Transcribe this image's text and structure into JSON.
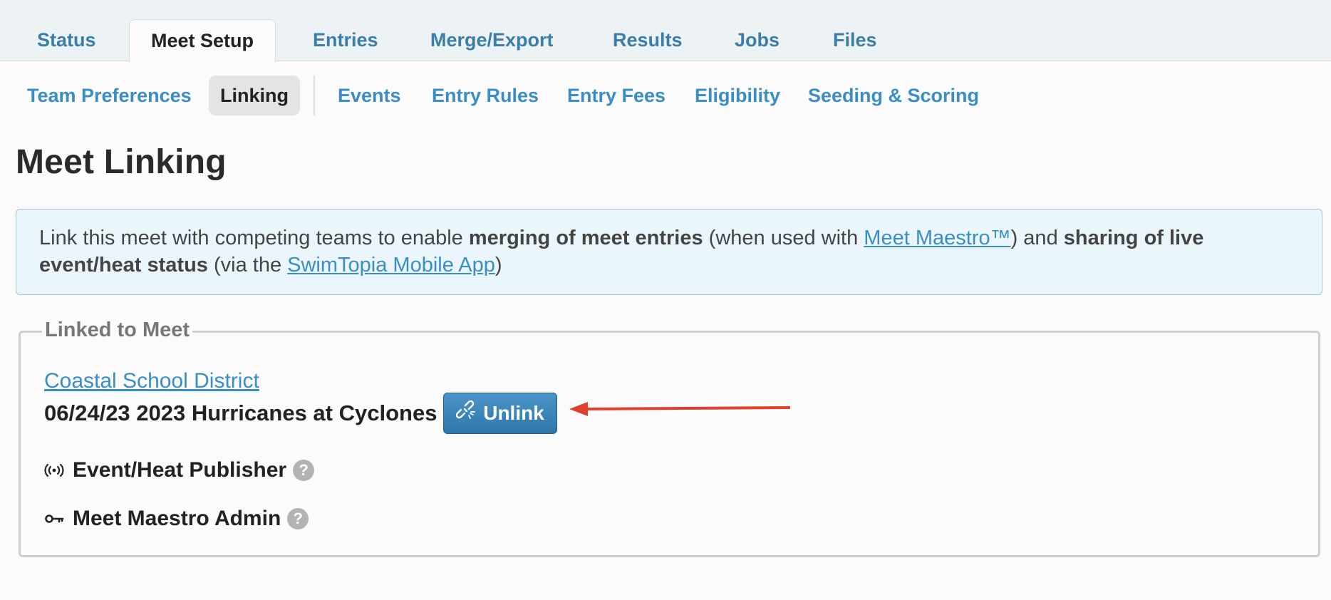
{
  "tabs": [
    "Status",
    "Meet Setup",
    "Entries",
    "Merge/Export",
    "Results",
    "Jobs",
    "Files"
  ],
  "active_tab": "Meet Setup",
  "subnav": [
    "Team Preferences",
    "Linking",
    "Events",
    "Entry Rules",
    "Entry Fees",
    "Eligibility",
    "Seeding & Scoring"
  ],
  "active_subnav": "Linking",
  "page_title": "Meet Linking",
  "info": {
    "t1": "Link this meet with competing teams to enable ",
    "b1": "merging of meet entries",
    "t2": " (when used with ",
    "link1": "Meet Maestro™",
    "t3": ") and ",
    "b2": "sharing of live event/heat status",
    "t4": " (via the ",
    "link2": "SwimTopia Mobile App",
    "t5": ")"
  },
  "linked": {
    "legend": "Linked to Meet",
    "district": "Coastal School District",
    "meet": "06/24/23 2023 Hurricanes at Cyclones",
    "unlink_label": "Unlink",
    "publisher_label": "Event/Heat Publisher",
    "admin_label": "Meet Maestro Admin",
    "help_glyph": "?"
  },
  "colors": {
    "link": "#3b8ec4",
    "tab": "#3b7ea8",
    "button": "#3a86bb",
    "arrow": "#e0402e",
    "info_bg": "#eaf6fc"
  },
  "icons": {
    "unlink": "broken-link-icon",
    "publisher": "broadcast-icon",
    "admin": "key-icon",
    "help": "question-circle-icon",
    "annotation": "red-arrow"
  }
}
